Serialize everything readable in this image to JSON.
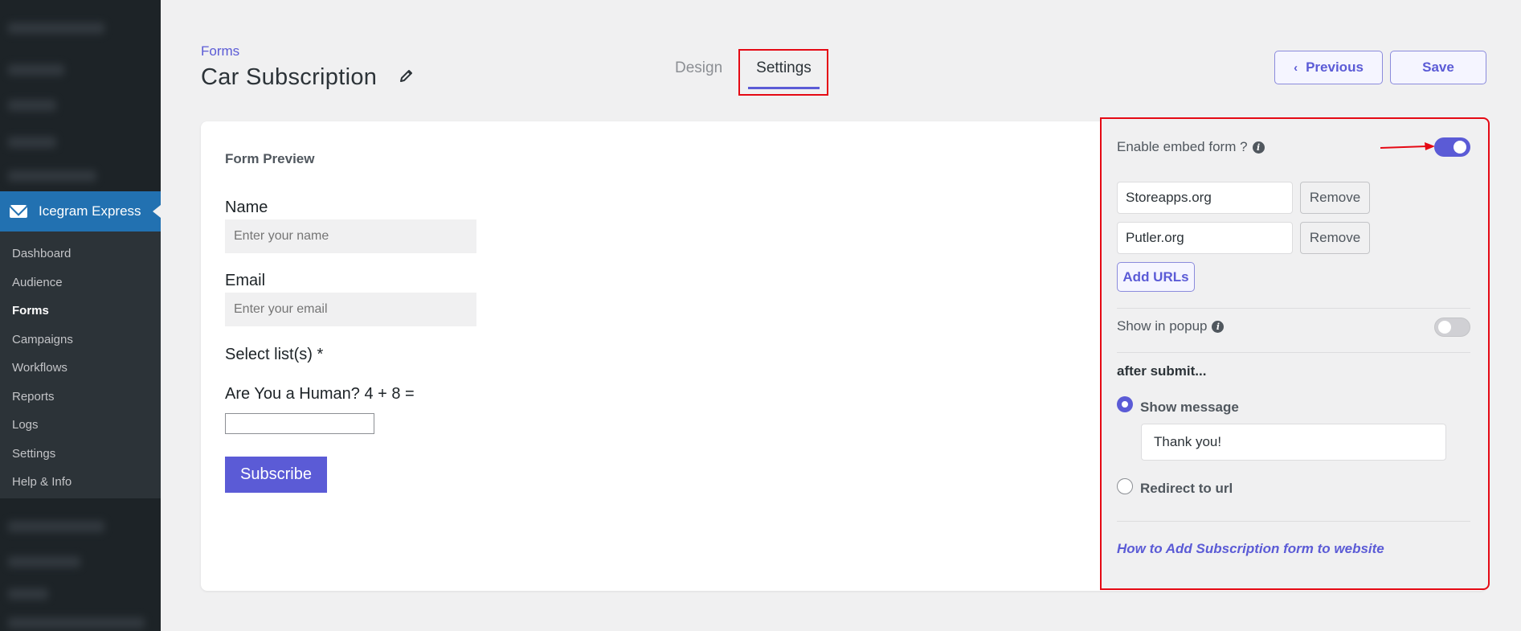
{
  "sidebar": {
    "plugin_name": "Icegram Express",
    "items": [
      {
        "label": "Dashboard"
      },
      {
        "label": "Audience"
      },
      {
        "label": "Forms"
      },
      {
        "label": "Campaigns"
      },
      {
        "label": "Workflows"
      },
      {
        "label": "Reports"
      },
      {
        "label": "Logs"
      },
      {
        "label": "Settings"
      },
      {
        "label": "Help & Info"
      }
    ],
    "current_item": "Forms"
  },
  "header": {
    "breadcrumb": "Forms",
    "title": "Car Subscription",
    "tabs": [
      {
        "label": "Design"
      },
      {
        "label": "Settings"
      }
    ],
    "active_tab": "Settings",
    "previous_label": "Previous",
    "save_label": "Save"
  },
  "preview": {
    "heading": "Form Preview",
    "name_label": "Name",
    "name_placeholder": "Enter your name",
    "email_label": "Email",
    "email_placeholder": "Enter your email",
    "list_label": "Select list(s) *",
    "captcha_label": "Are You a Human? 4 + 8 =",
    "subscribe_label": "Subscribe"
  },
  "settings": {
    "embed_label": "Enable embed form ?",
    "embed_enabled": true,
    "urls": [
      {
        "value": "Storeapps.org",
        "remove_label": "Remove"
      },
      {
        "value": "Putler.org",
        "remove_label": "Remove"
      }
    ],
    "add_urls_label": "Add URLs",
    "popup_label": "Show in popup",
    "popup_enabled": false,
    "after_submit_label": "after submit...",
    "show_message_label": "Show message",
    "message_value": "Thank you!",
    "redirect_label": "Redirect to url",
    "selected_option": "Show message",
    "help_link": "How to Add Subscription form to website"
  },
  "colors": {
    "accent": "#5b5bd6",
    "highlight": "#e50914",
    "sidebar_bg": "#23282d",
    "sidebar_active": "#2271b1"
  }
}
